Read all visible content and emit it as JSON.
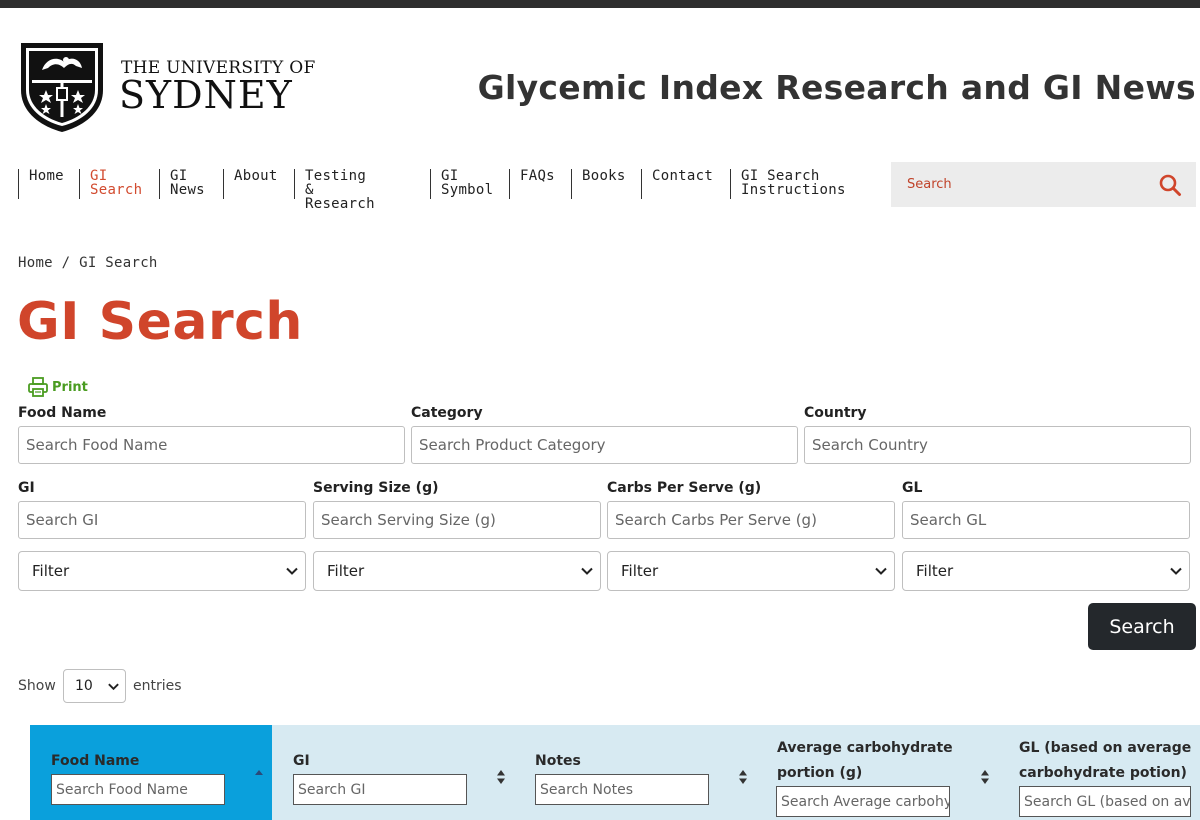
{
  "header": {
    "logo_line1": "THE UNIVERSITY OF",
    "logo_line2": "SYDNEY",
    "site_title": "Glycemic Index Research and GI News"
  },
  "nav": {
    "items": [
      {
        "line1": "Home",
        "line2": ""
      },
      {
        "line1": "GI",
        "line2": "Search"
      },
      {
        "line1": "GI",
        "line2": "News"
      },
      {
        "line1": "About",
        "line2": ""
      },
      {
        "line1": "Testing &",
        "line2": "Research"
      },
      {
        "line1": "GI",
        "line2": "Symbol"
      },
      {
        "line1": "FAQs",
        "line2": ""
      },
      {
        "line1": "Books",
        "line2": ""
      },
      {
        "line1": "Contact",
        "line2": ""
      },
      {
        "line1": "GI Search",
        "line2": "Instructions"
      }
    ],
    "search_placeholder": "Search"
  },
  "breadcrumb": "Home / GI Search",
  "page_title": "GI Search",
  "print_label": "Print",
  "filters": {
    "food_name": {
      "label": "Food Name",
      "placeholder": "Search Food Name"
    },
    "category": {
      "label": "Category",
      "placeholder": "Search Product Category"
    },
    "country": {
      "label": "Country",
      "placeholder": "Search Country"
    },
    "gi": {
      "label": "GI",
      "placeholder": "Search GI",
      "filter": "Filter"
    },
    "serving_size": {
      "label": "Serving Size (g)",
      "placeholder": "Search Serving Size (g)",
      "filter": "Filter"
    },
    "carbs": {
      "label": "Carbs Per Serve (g)",
      "placeholder": "Search Carbs Per Serve (g)",
      "filter": "Filter"
    },
    "gl": {
      "label": "GL",
      "placeholder": "Search GL",
      "filter": "Filter"
    }
  },
  "search_button": "Search",
  "length": {
    "show": "Show",
    "value": "10",
    "entries": "entries"
  },
  "table": {
    "columns": [
      {
        "label": "Food Name",
        "placeholder": "Search Food Name"
      },
      {
        "label": "GI",
        "placeholder": "Search GI"
      },
      {
        "label": "Notes",
        "placeholder": "Search Notes"
      },
      {
        "label_line1": "Average carbohydrate",
        "label_line2": "portion (g)",
        "placeholder": "Search Average carbohydrate portion (g)"
      },
      {
        "label_line1": "GL (based on average",
        "label_line2": "carbohydrate potion)",
        "placeholder": "Search GL (based on average carbohydrate potion)"
      }
    ]
  },
  "colors": {
    "accent": "#d0452b",
    "sorted_header": "#0aa0dc",
    "table_header": "#d7eaf2",
    "print_green": "#4a9c21"
  }
}
